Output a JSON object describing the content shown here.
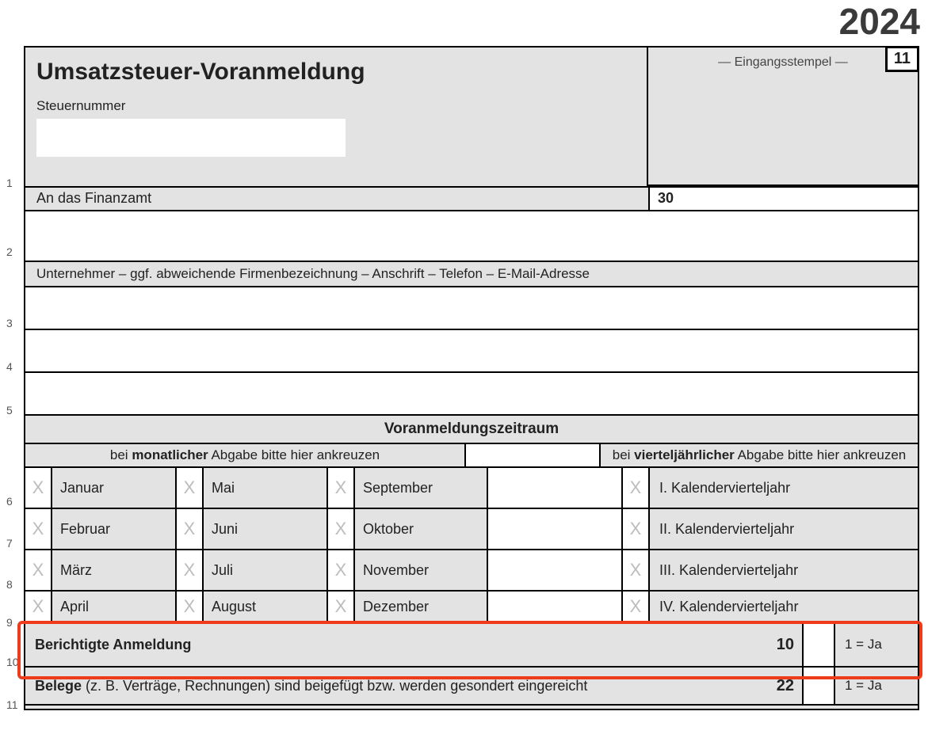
{
  "year": "2024",
  "title": "Umsatzsteuer-Voranmeldung",
  "steuernummer_label": "Steuernummer",
  "stamp_label": "—  Eingangsstempel  —",
  "corner_code": "11",
  "finanzamt_label": "An das Finanzamt",
  "finanzamt_code": "30",
  "unternehmer_label": "Unternehmer – ggf. abweichende Firmenbezeichnung – Anschrift – Telefon – E-Mail-Adresse",
  "period": {
    "header": "Voranmeldungszeitraum",
    "monthly_prefix": "bei ",
    "monthly_bold": "monatlicher",
    "monthly_suffix": " Abgabe bitte hier ankreuzen",
    "quarterly_prefix": "bei ",
    "quarterly_bold": "vierteljährlicher",
    "quarterly_suffix": " Abgabe bitte hier ankreuzen",
    "months": {
      "r1": [
        "Januar",
        "Mai",
        "September"
      ],
      "r2": [
        "Februar",
        "Juni",
        "Oktober"
      ],
      "r3": [
        "März",
        "Juli",
        "November"
      ],
      "r4": [
        "April",
        "August",
        "Dezember"
      ]
    },
    "quarters": [
      "I. Kalendervierteljahr",
      "II. Kalendervierteljahr",
      "III. Kalendervierteljahr",
      "IV. Kalendervierteljahr"
    ],
    "xmark": "X"
  },
  "row10": {
    "label": "Berichtigte Anmeldung",
    "code": "10",
    "hint": "1 = Ja"
  },
  "row11": {
    "label_bold": "Belege",
    "label_rest": " (z. B. Verträge, Rechnungen) sind beigefügt bzw. werden gesondert eingereicht",
    "code": "22",
    "hint": "1 = Ja"
  },
  "linenos": [
    "1",
    "2",
    "3",
    "4",
    "5",
    "6",
    "7",
    "8",
    "9",
    "10",
    "11"
  ]
}
